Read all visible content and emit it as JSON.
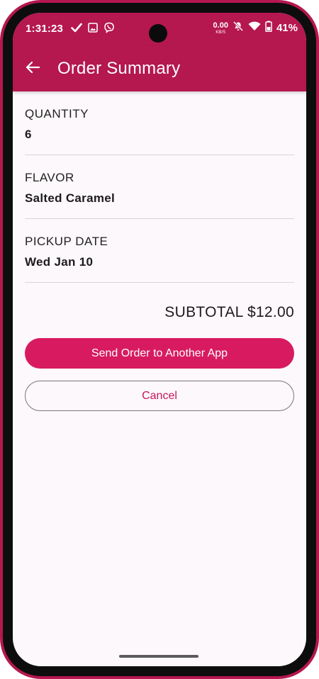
{
  "status_bar": {
    "time": "1:31:23",
    "left_icons": [
      "check-icon",
      "image-icon",
      "viber-icon"
    ],
    "net_speed_value": "0.00",
    "net_speed_unit": "KB/S",
    "right_icons": [
      "mute-icon",
      "wifi-icon",
      "battery-icon"
    ],
    "battery_percent": "41%"
  },
  "app_bar": {
    "back_icon": "arrow-back-icon",
    "title": "Order Summary"
  },
  "summary": {
    "fields": [
      {
        "label": "QUANTITY",
        "value": "6"
      },
      {
        "label": "FLAVOR",
        "value": "Salted Caramel"
      },
      {
        "label": "PICKUP DATE",
        "value": "Wed Jan 10"
      }
    ],
    "subtotal": "SUBTOTAL $12.00"
  },
  "actions": {
    "send_label": "Send Order to Another App",
    "cancel_label": "Cancel"
  },
  "colors": {
    "primary": "#b5174f",
    "button": "#d81b60",
    "cancel_text": "#c2185b",
    "background": "#fdf8fb"
  }
}
